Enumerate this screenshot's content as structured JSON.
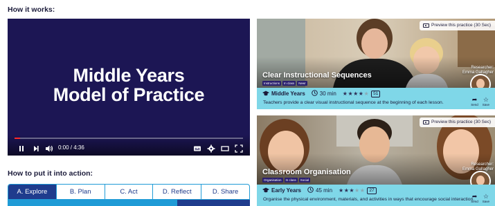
{
  "headings": {
    "how_it_works": "How it works:",
    "how_to_put": "How to put it into action:"
  },
  "video": {
    "title_line1": "Middle Years",
    "title_line2": "Model of Practice",
    "time": "0:00 / 4:36",
    "progress_fraction": 0.0
  },
  "tabs": [
    {
      "label": "A. Explore",
      "active": true
    },
    {
      "label": "B. Plan",
      "active": false
    },
    {
      "label": "C. Act",
      "active": false
    },
    {
      "label": "D. Reflect",
      "active": false
    },
    {
      "label": "D. Share",
      "active": false
    }
  ],
  "cards": [
    {
      "preview": "Preview this practice (30 Sec)",
      "title": "Clear Instructional Sequences",
      "tags": [
        "Instructions",
        "In class",
        "New!"
      ],
      "researcher_label": "Researcher:",
      "researcher_name": "Emma Gallagher",
      "level": "Middle Years",
      "duration": "30 min",
      "rating": 4,
      "rating_max": 5,
      "count": "51",
      "description": "Teachers provide a clear visual instructional sequence at the beginning of each lesson.",
      "send": "Send",
      "save": "Save"
    },
    {
      "preview": "Preview this practice (30 Sec)",
      "title": "Classroom Organisation",
      "tags": [
        "Organisation",
        "In class",
        "Social"
      ],
      "researcher_label": "Researcher:",
      "researcher_name": "Emma Gallagher",
      "level": "Early Years",
      "duration": "45 min",
      "rating": 3,
      "rating_max": 5,
      "count": "27",
      "description": "Organise the physical environment, materials, and activities in ways that encourage social interaction.",
      "send": "Send",
      "save": "Save"
    }
  ],
  "colors": {
    "video_bg": "#1c1654",
    "tab_active": "#1f3c8d",
    "tab_border": "#1f9bd6",
    "card_info": "#7fd7e8",
    "tag_bg": "#2a1f6e",
    "progress": "#ff2a2a"
  },
  "icons": [
    "play-icon",
    "next-icon",
    "volume-icon",
    "captions-icon",
    "gear-icon",
    "theater-icon",
    "fullscreen-icon",
    "clock-icon",
    "graduation-icon",
    "send-icon",
    "save-icon",
    "video-preview-icon"
  ]
}
